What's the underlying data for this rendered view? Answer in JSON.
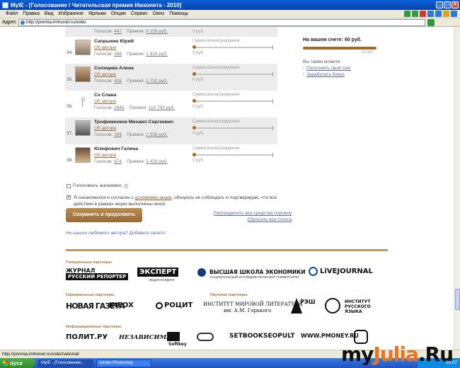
{
  "window": {
    "title": "MyIE - [Голосование / Читательская премия Имхонета - 2010]"
  },
  "menu": [
    "Файл",
    "Правка",
    "Вид",
    "Избранное",
    "Ярлыки",
    "Опции",
    "Сервис",
    "Окно",
    "Помощь"
  ],
  "address": {
    "label": "Адрес",
    "url": "http://premia.imhonet.ru/vote/"
  },
  "candidates": [
    {
      "num": "",
      "name": "",
      "about": "",
      "votes_label": "Голосов:",
      "votes": "447",
      "prize_label": "Премия:",
      "prize": "6 109 руб.",
      "reward_label": "",
      "reward_value": "0 руб."
    },
    {
      "num": "34.",
      "name": "Сапрыкин Юрий",
      "about": "Об авторе",
      "votes_label": "Голосов:",
      "votes": "388",
      "prize_label": "Премия:",
      "prize": "1 915 руб.",
      "reward_label": "Сумма вознаграждения:",
      "reward_value": "0 руб."
    },
    {
      "num": "35.",
      "name": "Солнцева Алена",
      "about": "Об авторе",
      "votes_label": "Голосов:",
      "votes": "408",
      "prize_label": "Премия:",
      "prize": "2 732 руб.",
      "reward_label": "Сумма вознаграждения:",
      "reward_value": "0 руб."
    },
    {
      "num": "36.",
      "name": "Сэ Слава",
      "about": "Об авторе",
      "votes_label": "Голосов:",
      "votes": "2845",
      "prize_label": "Премия:",
      "prize": "115 703 руб.",
      "reward_label": "Сумма вознаграждения:",
      "reward_value": "0 руб."
    },
    {
      "num": "37.",
      "name": "Трофименков Михаил Сергеевич",
      "about": "Об авторе",
      "votes_label": "Голосов:",
      "votes": "394",
      "prize_label": "Премия:",
      "prize": "2 538 руб.",
      "reward_label": "Сумма вознаграждения:",
      "reward_value": "0 руб."
    },
    {
      "num": "38.",
      "name": "Юзефович Галина",
      "about": "Об авторе",
      "votes_label": "Голосов:",
      "votes": "674",
      "prize_label": "Премия:",
      "prize": "5 429 руб.",
      "reward_label": "Сумма вознаграждения:",
      "reward_value": "0 руб."
    }
  ],
  "form": {
    "anon_label": "Голосовать анонимно",
    "agree_pre": "Я ознакомился и согласен с",
    "agree_link": "условиями акции",
    "agree_post": ", обязуюсь их соблюдать и подтверждаю, что все действия в рамках акции выполнены мной.",
    "save_button": "Сохранить и продолжить",
    "distribute_link": "Распределить все средства поровну",
    "reset_link": "Сбросить все голоса",
    "not_found_link": "Не нашли любимого автора? Добавьте своего!"
  },
  "sidebar": {
    "balance_label": "На вашем счете:",
    "balance_value": "60 руб.",
    "bar_value_label": "60 руб.",
    "also_label": "Вы также можете:",
    "links": [
      "Пополнить свой счет",
      "Заработать бонус"
    ]
  },
  "partners": {
    "general_title": "Генеральные партнеры",
    "official_title": "Официальные партнеры",
    "science_title": "Научные партнеры",
    "info_title": "Информационные партнеры",
    "general": [
      "ЖУРНАЛ",
      "РУССКИЙ РЕПОРТЕР",
      "ЭКСПЕРТ",
      "МЕДИАХОЛДИНГ",
      "ВЫСШАЯ ШКОЛА ЭКОНОМИКИ",
      "НАЦИОНАЛЬНЫЙ ИССЛЕДОВАТЕЛЬСКИЙ УНИВЕРСИТЕТ",
      "LiVEJOURNAL"
    ],
    "official": [
      "НОВАЯ ГАЗЕТА",
      "INFOX",
      "РОЦИТ"
    ],
    "science": [
      "ИНСТИТУТ МИРОВОЙ ЛИТЕРАТУРЫ",
      "им. А.М. Горького",
      "РЭШ",
      "ИНСТИТУТ РУССКОГО ЯЗЫКА"
    ],
    "info": [
      "ПОЛИТ.РУ",
      "НЕЗАВИСИМАЯ",
      "Softkey",
      "SETBOOK",
      "SEOPULT",
      "WWW.PMONEY.RU"
    ]
  },
  "status": {
    "text": "http://premia.imhonet.ru/vote/national/"
  },
  "taskbar": {
    "start": "пуск",
    "tasks": [
      "MyIE - [Голосование...",
      "Adobe Photoshop"
    ],
    "clock": "19:07"
  },
  "watermark": {
    "part1": "my",
    "part2": "Julia",
    "part3": ".Ru"
  }
}
